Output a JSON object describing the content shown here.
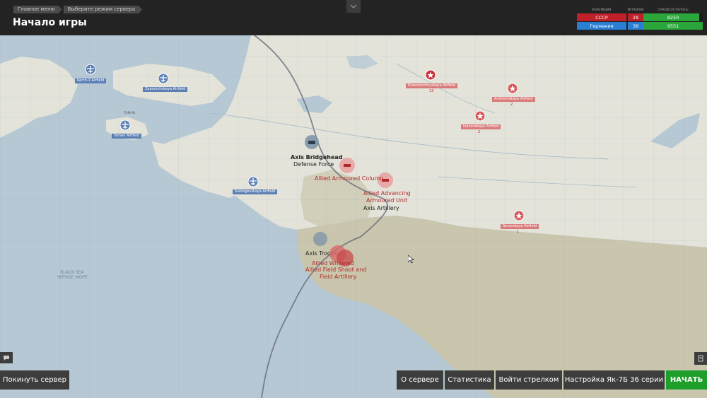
{
  "breadcrumb": [
    "Главное меню",
    "Выберите режим сервера"
  ],
  "page_title": "Начало игры",
  "scoreboard": {
    "headers": [
      "КОАЛИЦИЯ",
      "ИГРОКОВ",
      "ОЧКОВ ОСТАЛОСЬ"
    ],
    "rows": [
      {
        "team": "СССР",
        "players": "28",
        "points": "8250",
        "color": "#c0202a",
        "points_fill": 0.94
      },
      {
        "team": "Германия",
        "players": "36",
        "points": "9551",
        "color": "#2a7fd4",
        "points_fill": 1.0
      }
    ],
    "points_color": "#2aa63a"
  },
  "map": {
    "sea_label": [
      "BLACK SEA",
      "ЧЕРНОЕ МОРЕ"
    ],
    "blue_airfields": [
      "Kerch-1 Airfield",
      "Zaporozhskaya Airfield",
      "Taman Airfield",
      "Svetagevskaya Airfield"
    ],
    "red_airfields": [
      "Krasnoarmeyskaya Airfield",
      "Andreevskaya Airfield",
      "Ivanovskaya Airfield",
      "Severskaya Airfield"
    ],
    "red_counts": [
      "13",
      "2",
      "2",
      "1"
    ],
    "town_label": "TAMAN",
    "units": {
      "axis_bridgehead": "Axis Bridgehead",
      "defense_force": "Defense Force",
      "allied_armoured_column": "Allied Armoured Column",
      "allied_advancing": "Allied Advancing",
      "armoured_unit": "Armoured Unit",
      "axis_artillery": "Axis Artillery",
      "axis_troops": "Axis Troops",
      "allied_cluster_1": "Allied Wheeled",
      "allied_cluster_2": "Allied Field Shoot and",
      "allied_cluster_3": "Field Artillery"
    }
  },
  "buttons": {
    "leave": "Покинуть сервер",
    "about": "О сервере",
    "stats": "Статистика",
    "gunner": "Войти стрелком",
    "setup": "Настройка Як-7Б 36 серии",
    "start": "НАЧАТЬ"
  },
  "colors": {
    "sea": "#b6c8d4",
    "land": "#e3e3da",
    "mountain": "#c9c6ad",
    "topbar": "#232323",
    "button": "#3d3d3d",
    "start_button": "#1e9e2a",
    "allied": "#c0202a",
    "axis": "#5b7fb5"
  }
}
